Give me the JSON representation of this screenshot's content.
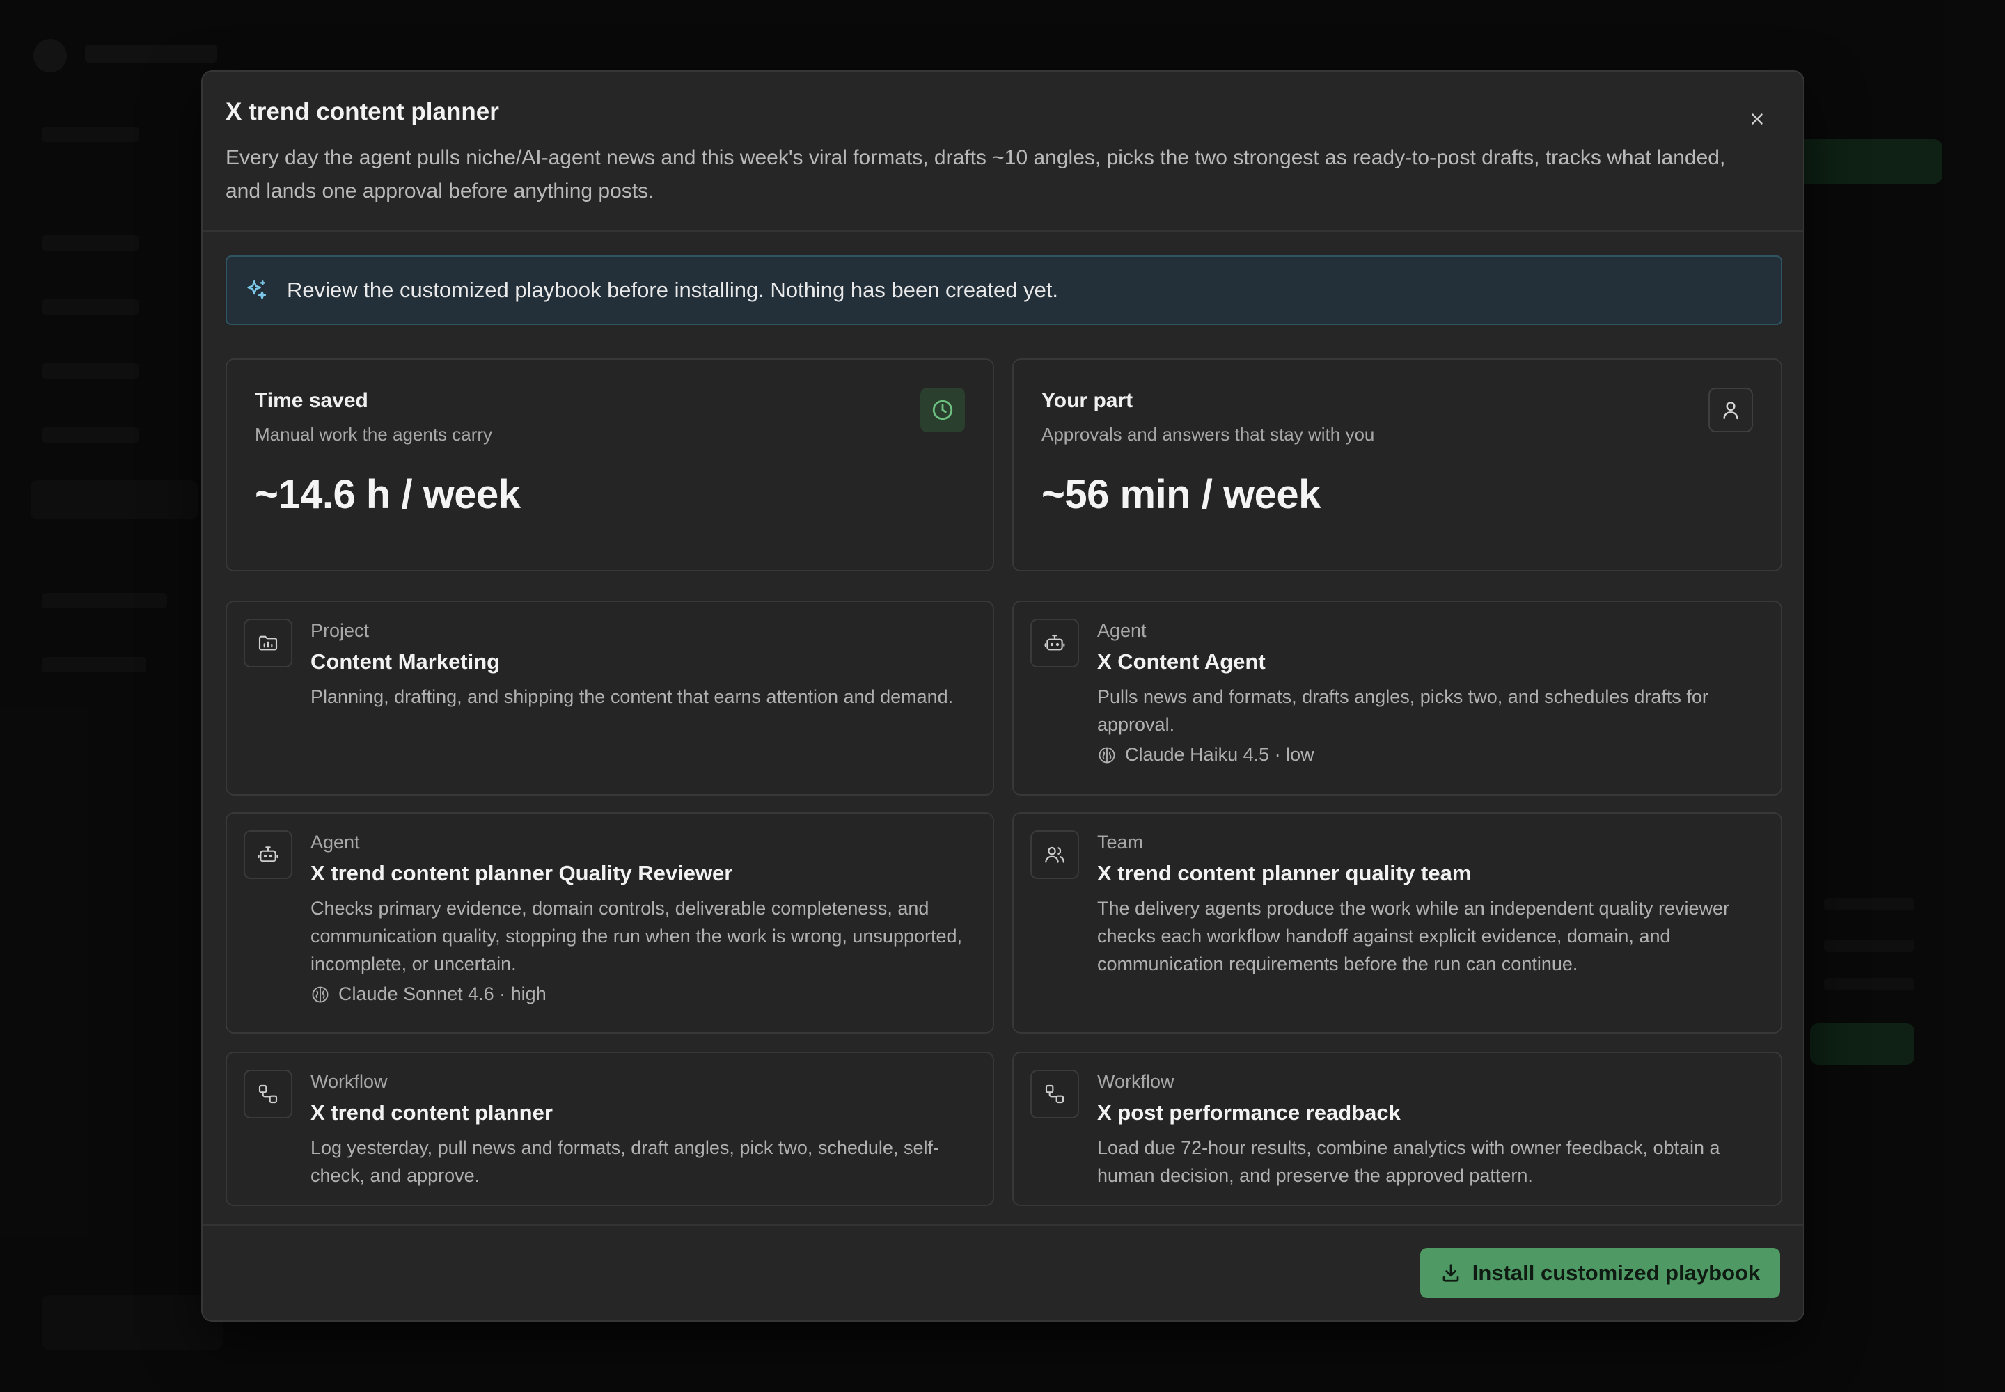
{
  "modal": {
    "title": "X trend content planner",
    "description": "Every day the agent pulls niche/AI-agent news and this week's viral formats, drafts ~10 angles, picks the two strongest as ready-to-post drafts, tracks what landed, and lands one approval before anything posts.",
    "close_icon": "x-icon"
  },
  "notice": {
    "icon": "sparkles-icon",
    "text": "Review the customized playbook before installing. Nothing has been created yet."
  },
  "stats": [
    {
      "title": "Time saved",
      "subtitle": "Manual work the agents carry",
      "value": "~14.6 h / week",
      "icon": "clock-icon"
    },
    {
      "title": "Your part",
      "subtitle": "Approvals and answers that stay with you",
      "value": "~56 min / week",
      "icon": "user-icon"
    }
  ],
  "items": [
    {
      "kind": "Project",
      "title": "Content Marketing",
      "description": "Planning, drafting, and shipping the content that earns attention and demand.",
      "icon": "folder-chart-icon"
    },
    {
      "kind": "Agent",
      "title": "X Content Agent",
      "description": "Pulls news and formats, drafts angles, picks two, and schedules drafts for approval.",
      "model": "Claude Haiku 4.5 · low",
      "icon": "bot-icon"
    },
    {
      "kind": "Agent",
      "title": "X trend content planner Quality Reviewer",
      "description": "Checks primary evidence, domain controls, deliverable completeness, and communication quality, stopping the run when the work is wrong, unsupported, incomplete, or uncertain.",
      "model": "Claude Sonnet 4.6 · high",
      "icon": "bot-icon"
    },
    {
      "kind": "Team",
      "title": "X trend content planner quality team",
      "description": "The delivery agents produce the work while an independent quality reviewer checks each workflow handoff against explicit evidence, domain, and communication requirements before the run can continue.",
      "icon": "users-icon"
    },
    {
      "kind": "Workflow",
      "title": "X trend content planner",
      "description": "Log yesterday, pull news and formats, draft angles, pick two, schedule, self-check, and approve.",
      "icon": "workflow-icon"
    },
    {
      "kind": "Workflow",
      "title": "X post performance readback",
      "description": "Load due 72-hour results, combine analytics with owner feedback, obtain a human decision, and preserve the approved pattern.",
      "icon": "workflow-icon"
    }
  ],
  "footer": {
    "install_label": "Install customized playbook",
    "install_icon": "download-icon"
  },
  "colors": {
    "accent_green": "#4f9a64",
    "notice_bg": "#23303a",
    "notice_border": "#2f5563"
  }
}
